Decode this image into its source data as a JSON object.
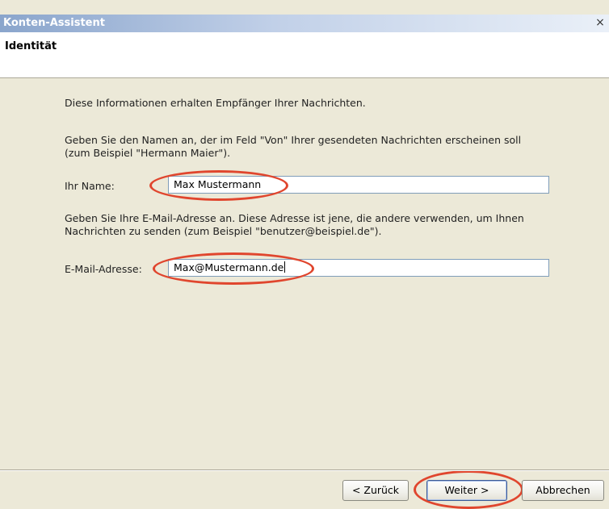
{
  "window": {
    "title": "Konten-Assistent",
    "close_symbol": "×"
  },
  "page": {
    "title": "Identität"
  },
  "content": {
    "intro": "Diese Informationen erhalten Empfänger Ihrer Nachrichten.",
    "name_help_line1": "Geben Sie den Namen an, der im Feld \"Von\" Ihrer gesendeten Nachrichten erscheinen soll",
    "name_help_line2": "(zum Beispiel \"Hermann Maier\").",
    "name_label": "Ihr Name:",
    "name_value": "Max Mustermann",
    "email_help_line1": "Geben Sie Ihre E-Mail-Adresse an. Diese Adresse ist jene, die andere verwenden, um Ihnen",
    "email_help_line2": "Nachrichten zu senden (zum Beispiel \"benutzer@beispiel.de\").",
    "email_label": "E-Mail-Adresse:",
    "email_value": "Max@Mustermann.de"
  },
  "buttons": {
    "back": "< Zurück",
    "next": "Weiter >",
    "cancel": "Abbrechen"
  },
  "colors": {
    "highlight_oval": "#e0462e",
    "dialog_background": "#ece9d8"
  },
  "icons": {
    "close": "close-icon"
  }
}
